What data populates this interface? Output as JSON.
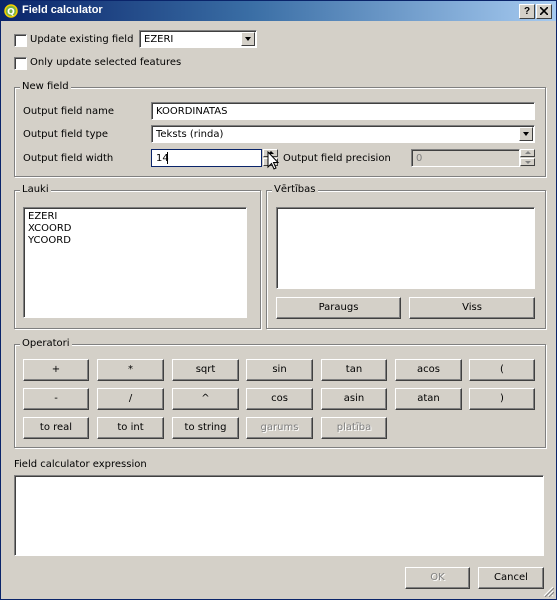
{
  "window": {
    "title": "Field calculator",
    "help_button": "?",
    "close_button": "X"
  },
  "top": {
    "update_existing_label": "Update existing field",
    "update_existing_checked": false,
    "existing_field_value": "EZERI",
    "only_selected_label": "Only update selected features",
    "only_selected_checked": false
  },
  "new_field": {
    "group_title": "New field",
    "name_label": "Output field name",
    "name_value": "KOORDINATAS",
    "type_label": "Output field type",
    "type_value": "Teksts (rinda)",
    "width_label": "Output field width",
    "width_value": "14",
    "precision_label": "Output field precision",
    "precision_value": "0"
  },
  "fields": {
    "group_title": "Lauki",
    "items": [
      "EZERI",
      "XCOORD",
      "YCOORD"
    ]
  },
  "values": {
    "group_title": "Vērtības",
    "sample_button": "Paraugs",
    "all_button": "Viss"
  },
  "operators": {
    "group_title": "Operatori",
    "row1": [
      "+",
      "*",
      "sqrt",
      "sin",
      "tan",
      "acos",
      "("
    ],
    "row2": [
      "-",
      "/",
      "^",
      "cos",
      "asin",
      "atan",
      ")"
    ],
    "row3": [
      "to real",
      "to int",
      "to string",
      "garums",
      "platība"
    ]
  },
  "expression": {
    "label": "Field calculator expression",
    "value": ""
  },
  "footer": {
    "ok_button": "OK",
    "cancel_button": "Cancel"
  },
  "colors": {
    "titlebar_start": "#0a246a",
    "titlebar_end": "#a6caf0",
    "dialog_bg": "#d4d0c8"
  }
}
